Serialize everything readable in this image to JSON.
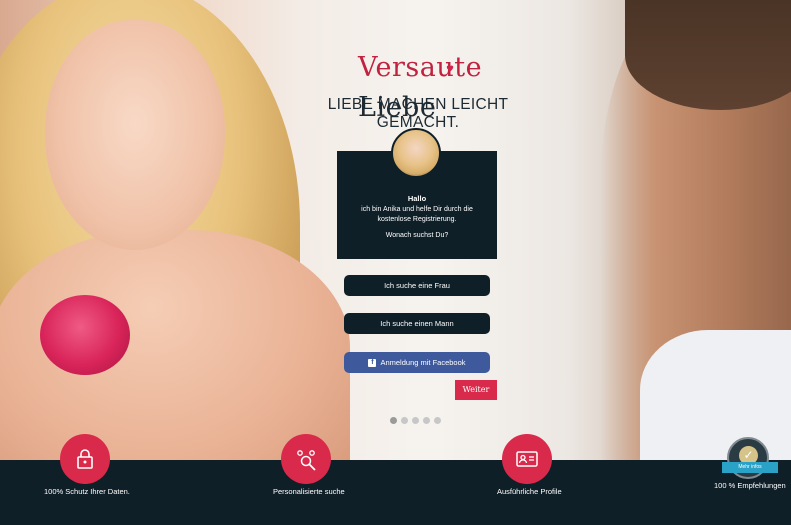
{
  "brand": {
    "logo_part1": "Versaute",
    "logo_part2": "Liebe",
    "tagline": "LIEBE MACHEN LEICHT GEMACHT."
  },
  "chat": {
    "greeting": "Hallo",
    "body": "ich bin Anika und helfe Dir durch die\nkostenlose Registrierung.",
    "question": "Wonach suchst Du?"
  },
  "options": [
    {
      "label": "Ich suche eine Frau"
    },
    {
      "label": "Ich suche einen Mann"
    }
  ],
  "facebook": {
    "label": "Anmeldung mit Facebook",
    "icon": "f"
  },
  "next_label": "Weiter",
  "progress": {
    "total_steps": 5,
    "current_step": 1
  },
  "features": [
    {
      "icon": "lock-icon",
      "label": "100% Schutz Ihrer Daten."
    },
    {
      "icon": "search-people-icon",
      "label": "Personalisierte suche"
    },
    {
      "icon": "profile-card-icon",
      "label": "Ausführliche Profile"
    }
  ],
  "seal": {
    "ribbon_text": "Mehr infos",
    "label": "100 % Empfehlungen"
  },
  "colors": {
    "accent": "#d92a4b",
    "dark": "#0f1f28",
    "facebook": "#3e5a9c"
  }
}
